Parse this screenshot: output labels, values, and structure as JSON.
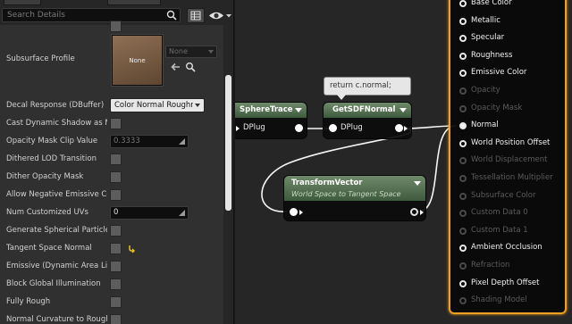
{
  "details": {
    "search_placeholder": "Search Details",
    "section_top_label": "",
    "subsurface": {
      "label": "Subsurface Profile",
      "thumb_text": "None",
      "asset_value": "None"
    },
    "rows": [
      {
        "label": "Decal Response (DBuffer)",
        "kind": "combo",
        "value": "Color Normal Roughness"
      },
      {
        "label": "Cast Dynamic Shadow as Masked",
        "kind": "checkbox",
        "checked": false
      },
      {
        "label": "Opacity Mask Clip Value",
        "kind": "number",
        "value": "0.3333",
        "dim": true
      },
      {
        "label": "Dithered LOD Transition",
        "kind": "checkbox",
        "checked": false
      },
      {
        "label": "Dither Opacity Mask",
        "kind": "checkbox",
        "checked": false
      },
      {
        "label": "Allow Negative Emissive Color",
        "kind": "checkbox",
        "checked": false
      },
      {
        "label": "Num Customized UVs",
        "kind": "number",
        "value": "0",
        "dim": false
      },
      {
        "label": "Generate Spherical Particle Normals",
        "kind": "checkbox",
        "checked": false
      },
      {
        "label": "Tangent Space Normal",
        "kind": "checkbox",
        "checked": false,
        "reset": true
      },
      {
        "label": "Emissive (Dynamic Area Light)",
        "kind": "checkbox",
        "checked": false
      },
      {
        "label": "Block Global Illumination",
        "kind": "checkbox",
        "checked": false
      },
      {
        "label": "Fully Rough",
        "kind": "checkbox",
        "checked": false
      },
      {
        "label": "Normal Curvature to Roughness",
        "kind": "checkbox",
        "checked": false
      }
    ]
  },
  "graph": {
    "comment": "return c.normal;",
    "nodes": {
      "sphere_trace": {
        "title": "SphereTrace",
        "out_label": "DPlug"
      },
      "get_sdf_normal": {
        "title": "GetSDFNormal",
        "in_label": "DPlug"
      },
      "transform_vector": {
        "title": "TransformVector",
        "subtitle": "World Space to Tangent Space"
      }
    },
    "result_pins": [
      {
        "label": "Base Color",
        "enabled": true,
        "connected": false
      },
      {
        "label": "Metallic",
        "enabled": true,
        "connected": false
      },
      {
        "label": "Specular",
        "enabled": true,
        "connected": false
      },
      {
        "label": "Roughness",
        "enabled": true,
        "connected": false
      },
      {
        "label": "Emissive Color",
        "enabled": true,
        "connected": false
      },
      {
        "label": "Opacity",
        "enabled": false,
        "connected": false
      },
      {
        "label": "Opacity Mask",
        "enabled": false,
        "connected": false
      },
      {
        "label": "Normal",
        "enabled": true,
        "connected": true
      },
      {
        "label": "World Position Offset",
        "enabled": true,
        "connected": false
      },
      {
        "label": "World Displacement",
        "enabled": false,
        "connected": false
      },
      {
        "label": "Tessellation Multiplier",
        "enabled": false,
        "connected": false
      },
      {
        "label": "Subsurface Color",
        "enabled": false,
        "connected": false
      },
      {
        "label": "Custom Data 0",
        "enabled": false,
        "connected": false
      },
      {
        "label": "Custom Data 1",
        "enabled": false,
        "connected": false
      },
      {
        "label": "Ambient Occlusion",
        "enabled": true,
        "connected": false
      },
      {
        "label": "Refraction",
        "enabled": false,
        "connected": false
      },
      {
        "label": "Pixel Depth Offset",
        "enabled": true,
        "connected": false
      },
      {
        "label": "Shading Model",
        "enabled": false,
        "connected": false
      }
    ]
  },
  "colors": {
    "result_border": "#f0a020",
    "node_header": "#4e6b4c",
    "reset_arrow": "#e8c020"
  }
}
